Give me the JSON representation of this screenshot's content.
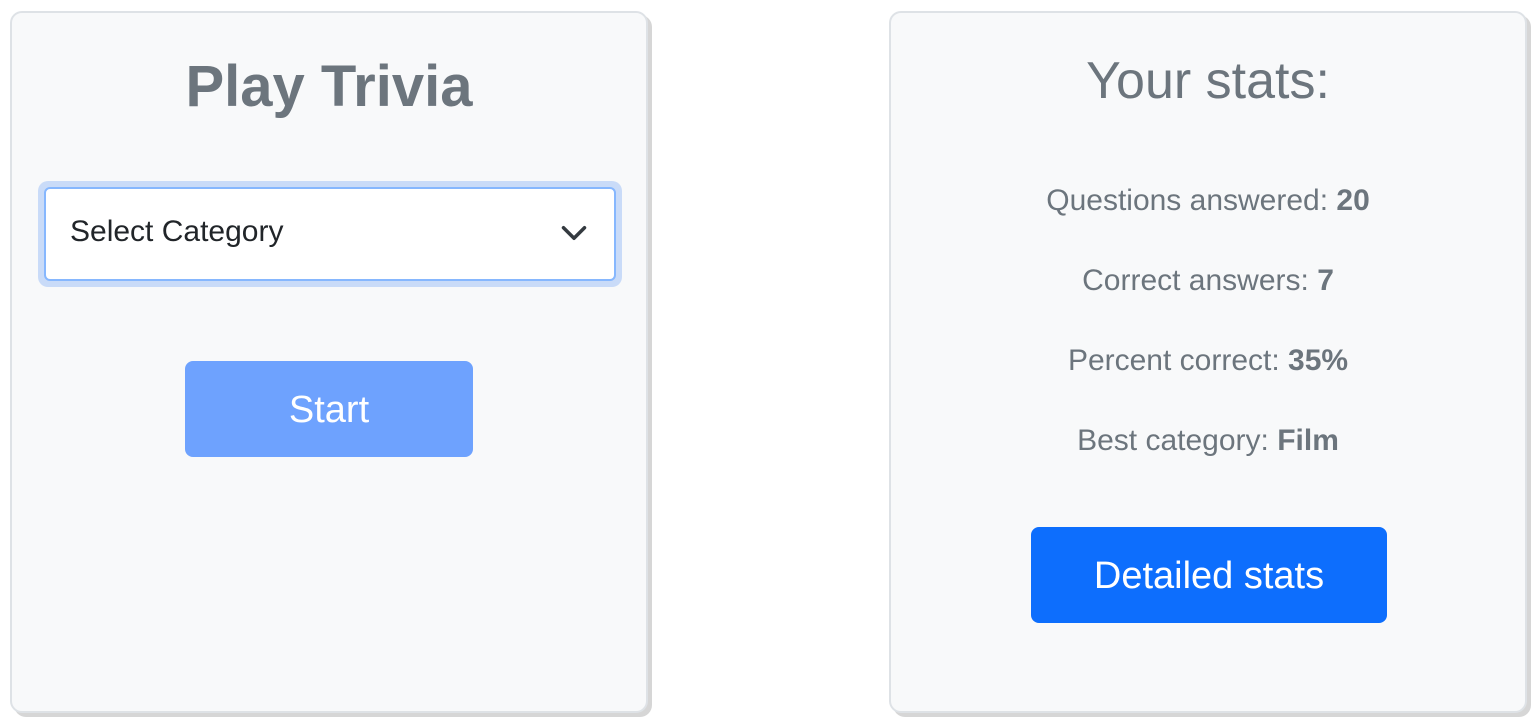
{
  "trivia": {
    "title": "Play Trivia",
    "select": {
      "selected": "Select Category",
      "icon": "chevron-down-icon"
    },
    "start_label": "Start"
  },
  "stats": {
    "title": "Your stats:",
    "questions_answered": {
      "label": "Questions answered: ",
      "value": "20"
    },
    "correct_answers": {
      "label": "Correct answers: ",
      "value": "7"
    },
    "percent_correct": {
      "label": "Percent correct: ",
      "value": "35%"
    },
    "best_category": {
      "label": "Best category: ",
      "value": "Film"
    },
    "detailed_label": "Detailed stats"
  },
  "colors": {
    "primary": "#0d6efd",
    "primary_disabled": "#6ea2fe",
    "muted_text": "#6c757d",
    "card_bg": "#f8f9fa",
    "focus_ring": "#c9dbf8"
  }
}
